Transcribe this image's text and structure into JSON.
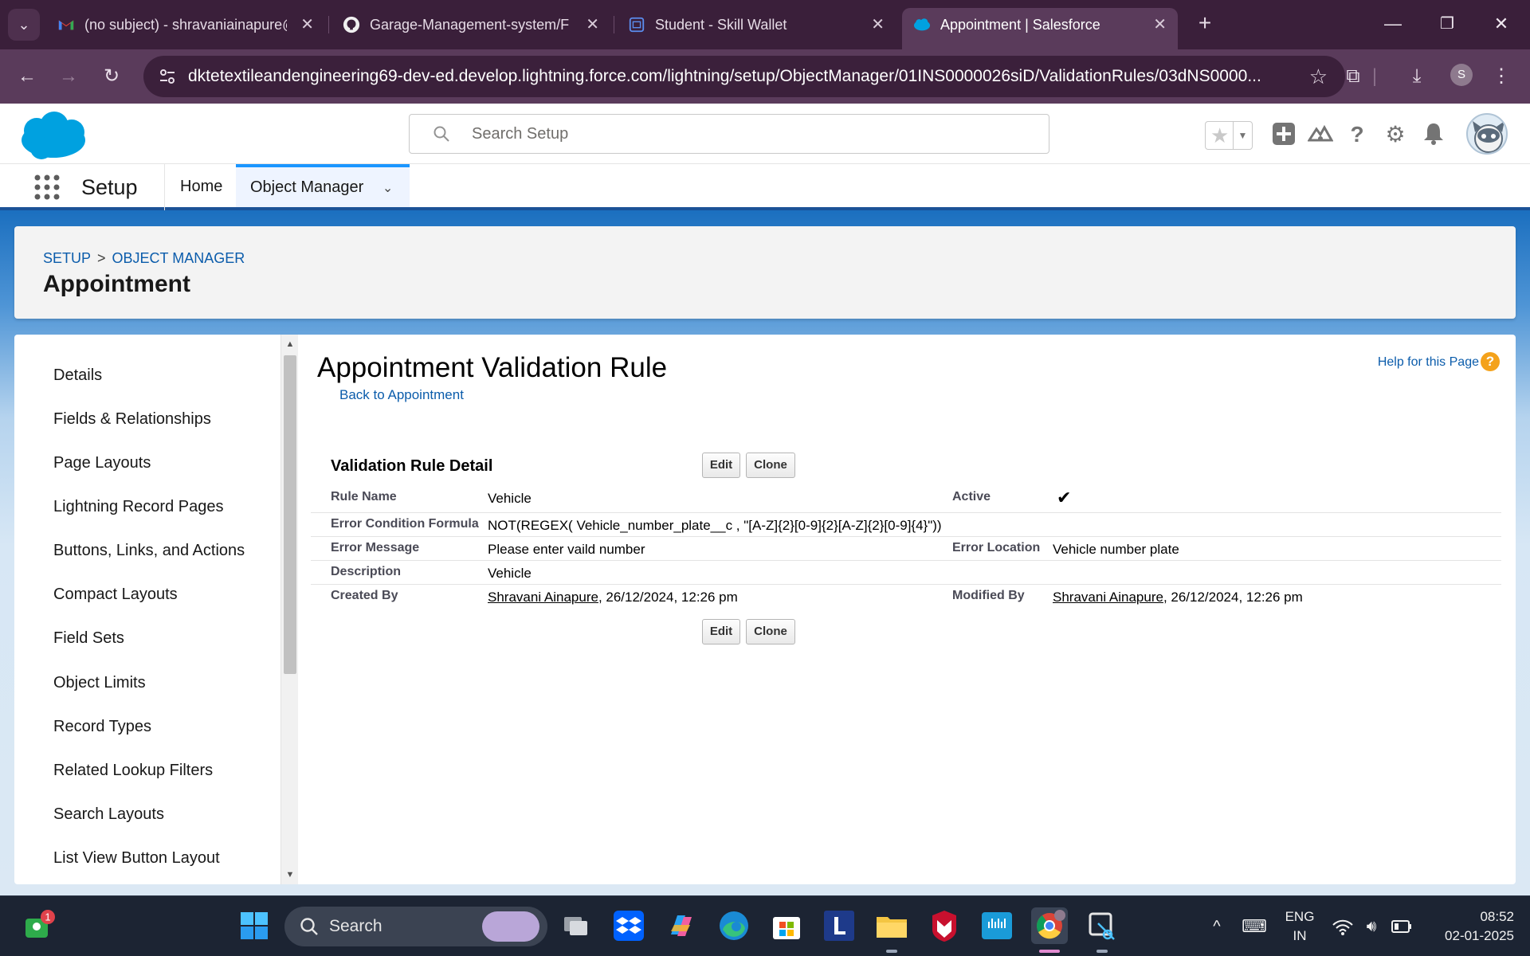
{
  "browser": {
    "tabs": [
      {
        "title": "(no subject) - shravaniainapure@",
        "icon": "gmail-icon"
      },
      {
        "title": "Garage-Management-system/F",
        "icon": "github-icon"
      },
      {
        "title": "Student - Skill Wallet",
        "icon": "skillwallet-icon"
      },
      {
        "title": "Appointment | Salesforce",
        "icon": "salesforce-icon",
        "active": true
      }
    ],
    "url": "dktetextileandengineering69-dev-ed.develop.lightning.force.com/lightning/setup/ObjectManager/01INS0000026siD/ValidationRules/03dNS0000...",
    "profile_initial": "S"
  },
  "sf_header": {
    "search_placeholder": "Search Setup"
  },
  "sf_nav": {
    "app_name": "Setup",
    "items": [
      "Home",
      "Object Manager"
    ]
  },
  "page_header": {
    "breadcrumb": [
      "SETUP",
      "OBJECT MANAGER"
    ],
    "breadcrumb_sep": ">",
    "title": "Appointment"
  },
  "left_nav": {
    "items": [
      "Details",
      "Fields & Relationships",
      "Page Layouts",
      "Lightning Record Pages",
      "Buttons, Links, and Actions",
      "Compact Layouts",
      "Field Sets",
      "Object Limits",
      "Record Types",
      "Related Lookup Filters",
      "Search Layouts",
      "List View Button Layout"
    ]
  },
  "rule": {
    "title": "Appointment Validation Rule",
    "back_link": "Back to Appointment",
    "help_link": "Help for this Page",
    "help_badge": "?",
    "section_title": "Validation Rule Detail",
    "edit_label": "Edit",
    "clone_label": "Clone",
    "fields": {
      "rule_name_label": "Rule Name",
      "rule_name": "Vehicle",
      "active_label": "Active",
      "active_mark": "✔",
      "formula_label": "Error Condition Formula",
      "formula": "NOT(REGEX( Vehicle_number_plate__c , \"[A-Z]{2}[0-9]{2}[A-Z]{2}[0-9]{4}\"))",
      "error_message_label": "Error Message",
      "error_message": "Please enter vaild number",
      "error_location_label": "Error Location",
      "error_location": "Vehicle number plate",
      "description_label": "Description",
      "description": "Vehicle",
      "created_by_label": "Created By",
      "created_by_user": "Shravani Ainapure",
      "created_by_date": ", 26/12/2024, 12:26 pm",
      "modified_by_label": "Modified By",
      "modified_by_user": "Shravani Ainapure",
      "modified_by_date": ", 26/12/2024, 12:26 pm"
    }
  },
  "taskbar": {
    "search_label": "Search",
    "notification_count": "1",
    "lang": "ENG",
    "region": "IN",
    "time": "08:52",
    "date": "02-01-2025"
  }
}
